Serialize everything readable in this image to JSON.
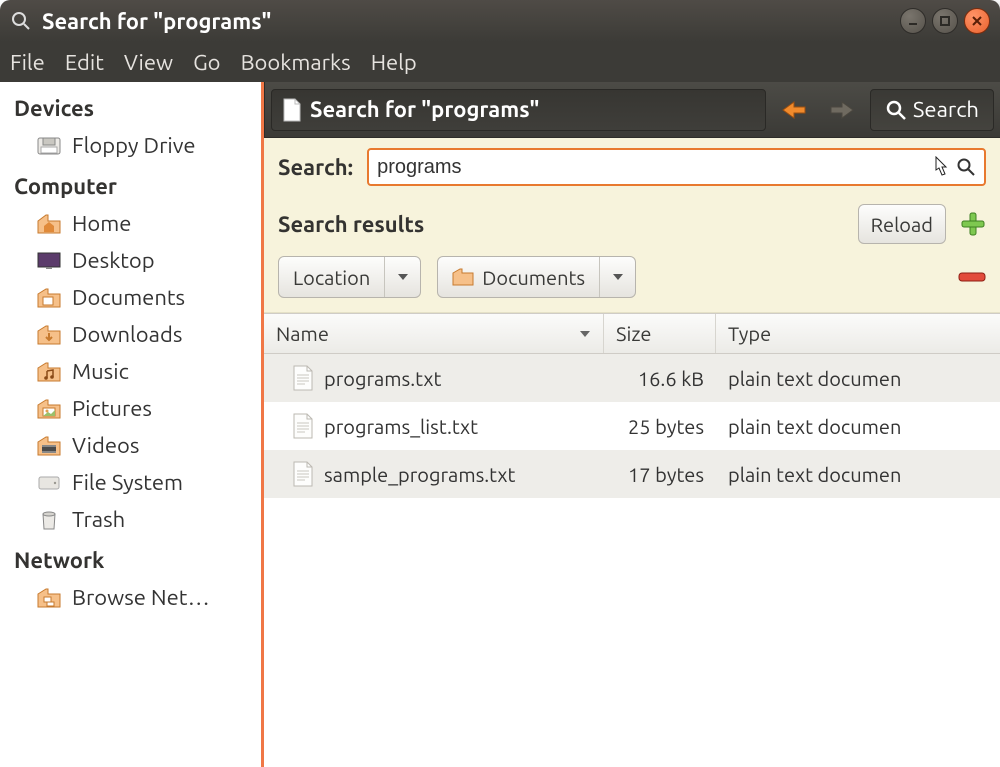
{
  "window": {
    "title": "Search for \"programs\""
  },
  "menubar": [
    "File",
    "Edit",
    "View",
    "Go",
    "Bookmarks",
    "Help"
  ],
  "sidebar": {
    "sections": [
      {
        "label": "Devices",
        "items": [
          {
            "icon": "floppy",
            "label": "Floppy Drive"
          }
        ]
      },
      {
        "label": "Computer",
        "items": [
          {
            "icon": "home",
            "label": "Home"
          },
          {
            "icon": "desktop",
            "label": "Desktop"
          },
          {
            "icon": "folder",
            "label": "Documents"
          },
          {
            "icon": "folder",
            "label": "Downloads"
          },
          {
            "icon": "folder",
            "label": "Music"
          },
          {
            "icon": "folder",
            "label": "Pictures"
          },
          {
            "icon": "folder",
            "label": "Videos"
          },
          {
            "icon": "disk",
            "label": "File System"
          },
          {
            "icon": "trash",
            "label": "Trash"
          }
        ]
      },
      {
        "label": "Network",
        "items": [
          {
            "icon": "folder",
            "label": "Browse Net…"
          }
        ]
      }
    ]
  },
  "toolbar": {
    "path_title": "Search for \"programs\"",
    "search_label": "Search"
  },
  "search": {
    "label": "Search:",
    "value": "programs",
    "results_label": "Search results",
    "reload_label": "Reload",
    "filter1": "Location",
    "filter2": "Documents"
  },
  "table": {
    "columns": {
      "name": "Name",
      "size": "Size",
      "type": "Type"
    },
    "rows": [
      {
        "name": "programs.txt",
        "size": "16.6 kB",
        "type": "plain text documen"
      },
      {
        "name": "programs_list.txt",
        "size": "25 bytes",
        "type": "plain text documen"
      },
      {
        "name": "sample_programs.txt",
        "size": "17 bytes",
        "type": "plain text documen"
      }
    ]
  }
}
